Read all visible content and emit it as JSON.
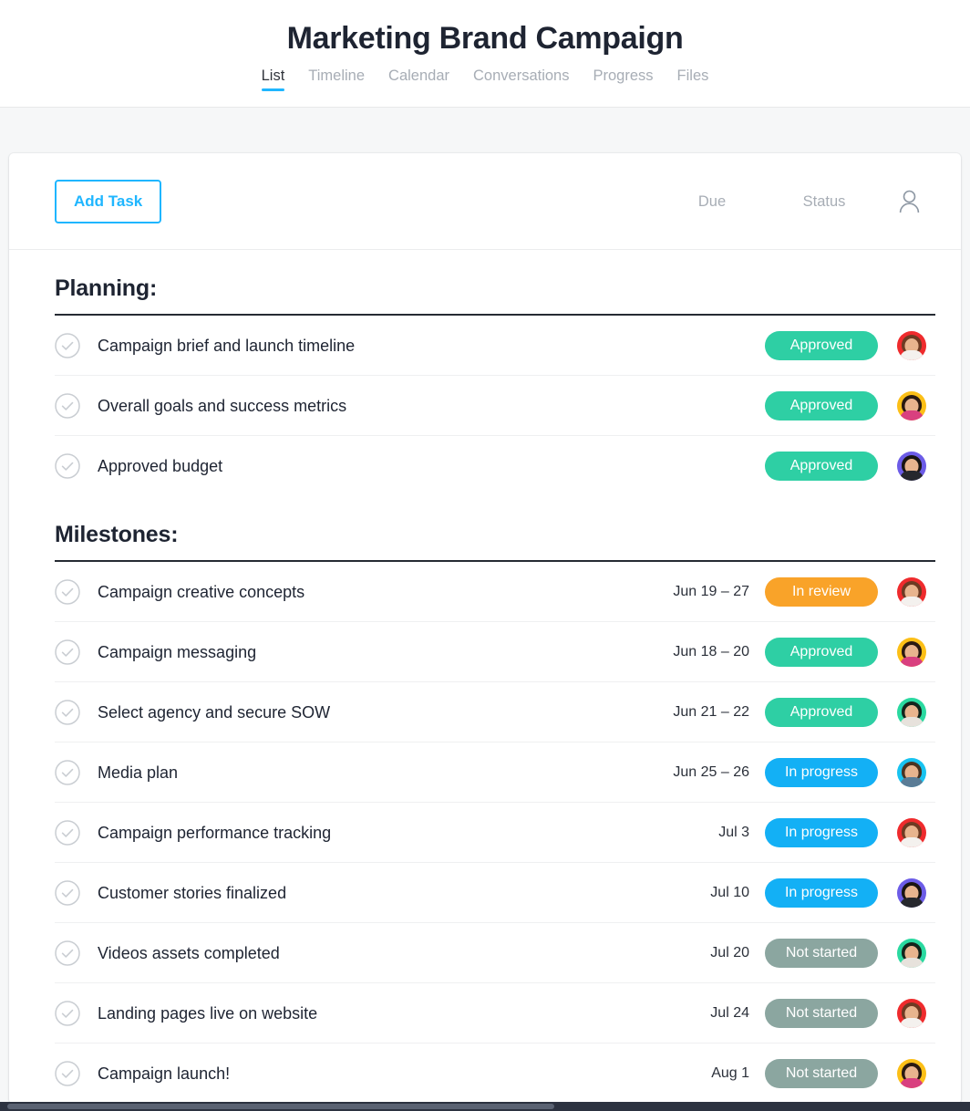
{
  "header": {
    "title": "Marketing Brand Campaign",
    "tabs": [
      {
        "label": "List",
        "active": true
      },
      {
        "label": "Timeline",
        "active": false
      },
      {
        "label": "Calendar",
        "active": false
      },
      {
        "label": "Conversations",
        "active": false
      },
      {
        "label": "Progress",
        "active": false
      },
      {
        "label": "Files",
        "active": false
      }
    ]
  },
  "toolbar": {
    "add_task_label": "Add Task",
    "due_column_label": "Due",
    "status_column_label": "Status",
    "assignee_column_icon": "person-icon"
  },
  "colors": {
    "accent_blue": "#1fb6ff",
    "approved": "#2ecfa4",
    "in_review": "#f9a329",
    "in_progress": "#13b0f5",
    "not_started": "#8ba6a0",
    "title_text": "#1e2432",
    "muted_text": "#a7adb5",
    "page_bg": "#f6f7f8"
  },
  "sections": [
    {
      "title": "Planning:",
      "tasks": [
        {
          "name": "Campaign brief and launch timeline",
          "due": "",
          "status": "Approved",
          "status_color": "#2ecfa4",
          "avatar_bg": "#ef2b2d",
          "avatar_hair": "#6d3b23",
          "avatar_body": "#f4f1ee"
        },
        {
          "name": "Overall goals and success metrics",
          "due": "",
          "status": "Approved",
          "status_color": "#2ecfa4",
          "avatar_bg": "#fcbf17",
          "avatar_hair": "#2a1a12",
          "avatar_body": "#d9407f"
        },
        {
          "name": "Approved budget",
          "due": "",
          "status": "Approved",
          "status_color": "#2ecfa4",
          "avatar_bg": "#6c5ce7",
          "avatar_hair": "#191512",
          "avatar_body": "#26282d"
        }
      ]
    },
    {
      "title": "Milestones:",
      "tasks": [
        {
          "name": "Campaign creative concepts",
          "due": "Jun 19 – 27",
          "status": "In review",
          "status_color": "#f9a329",
          "avatar_bg": "#ef2b2d",
          "avatar_hair": "#6d3b23",
          "avatar_body": "#f4f1ee"
        },
        {
          "name": "Campaign messaging",
          "due": "Jun 18 – 20",
          "status": "Approved",
          "status_color": "#2ecfa4",
          "avatar_bg": "#fcbf17",
          "avatar_hair": "#2a1a12",
          "avatar_body": "#d9407f"
        },
        {
          "name": "Select agency and secure SOW",
          "due": "Jun 21 – 22",
          "status": "Approved",
          "status_color": "#2ecfa4",
          "avatar_bg": "#2ad9a0",
          "avatar_hair": "#14241c",
          "avatar_body": "#e7e2dc"
        },
        {
          "name": "Media plan",
          "due": "Jun 25 – 26",
          "status": "In progress",
          "status_color": "#13b0f5",
          "avatar_bg": "#18c3f0",
          "avatar_hair": "#4a3322",
          "avatar_body": "#5a7c96"
        },
        {
          "name": "Campaign performance tracking",
          "due": "Jul 3",
          "status": "In progress",
          "status_color": "#13b0f5",
          "avatar_bg": "#ef2b2d",
          "avatar_hair": "#6d3b23",
          "avatar_body": "#f4f1ee"
        },
        {
          "name": "Customer stories finalized",
          "due": "Jul 10",
          "status": "In progress",
          "status_color": "#13b0f5",
          "avatar_bg": "#6c5ce7",
          "avatar_hair": "#191512",
          "avatar_body": "#26282d"
        },
        {
          "name": "Videos assets completed",
          "due": "Jul 20",
          "status": "Not started",
          "status_color": "#8ba6a0",
          "avatar_bg": "#2ad9a0",
          "avatar_hair": "#14241c",
          "avatar_body": "#e7e2dc"
        },
        {
          "name": "Landing pages live on website",
          "due": "Jul 24",
          "status": "Not started",
          "status_color": "#8ba6a0",
          "avatar_bg": "#ef2b2d",
          "avatar_hair": "#6d3b23",
          "avatar_body": "#f4f1ee"
        },
        {
          "name": "Campaign launch!",
          "due": "Aug 1",
          "status": "Not started",
          "status_color": "#8ba6a0",
          "avatar_bg": "#fcbf17",
          "avatar_hair": "#2a1a12",
          "avatar_body": "#d9407f"
        }
      ]
    }
  ]
}
